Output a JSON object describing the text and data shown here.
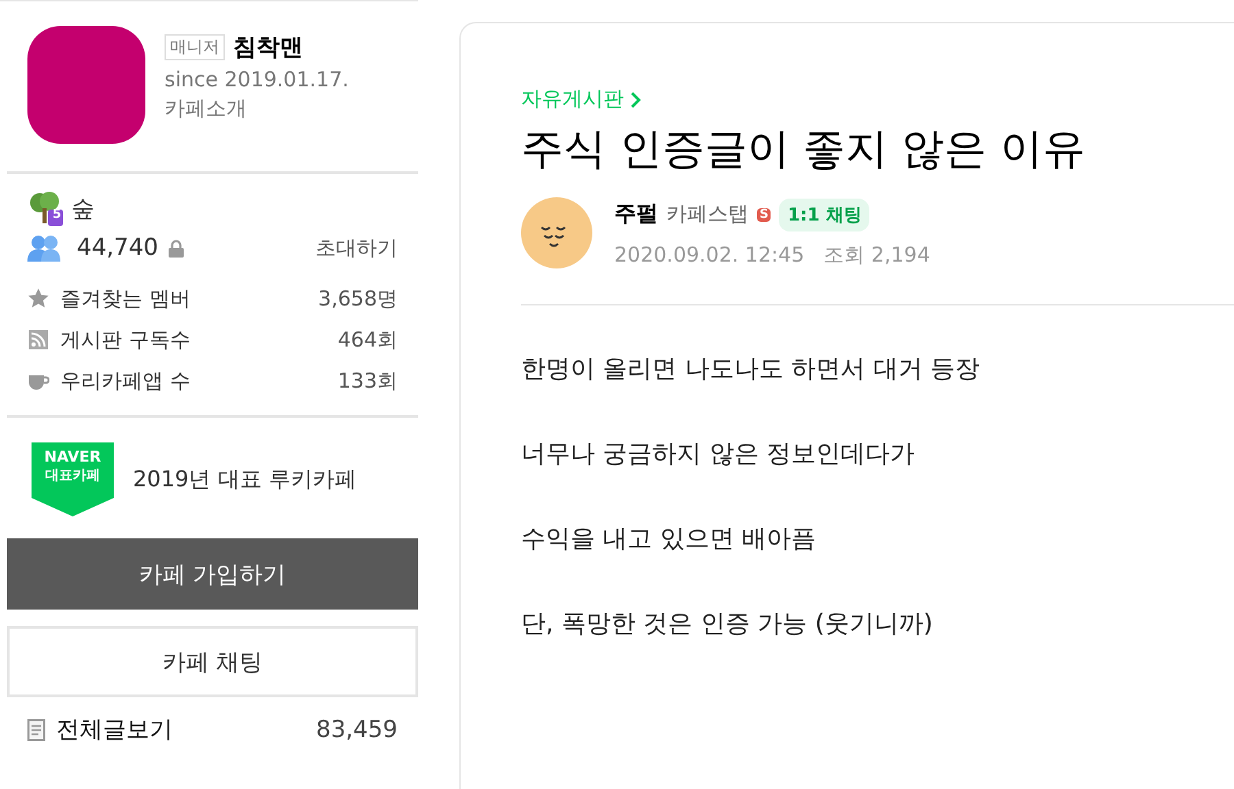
{
  "cafe": {
    "role_badge": "매니저",
    "manager": "침착맨",
    "since": "since 2019.01.17.",
    "intro_link": "카페소개"
  },
  "stats": {
    "level": "숲",
    "level_badge": "5",
    "members": "44,740",
    "invite": "초대하기",
    "rows": [
      {
        "kind": "star",
        "label": "즐겨찾는 멤버",
        "value": "3,658명"
      },
      {
        "kind": "rss",
        "label": "게시판 구독수",
        "value": "464회"
      },
      {
        "kind": "cup",
        "label": "우리카페앱 수",
        "value": "133회"
      }
    ]
  },
  "award": {
    "badge_top": "NAVER",
    "badge_bottom": "대표카페",
    "text": "2019년 대표 루키카페"
  },
  "buttons": [
    {
      "kind": "primary",
      "label": "카페 가입하기"
    },
    {
      "kind": "outline",
      "label": "카페 채팅"
    }
  ],
  "menu": [
    {
      "label": "전체글보기",
      "count": "83,459"
    }
  ],
  "article": {
    "board": "자유게시판",
    "title": "주식 인증글이 좋지 않은 이유",
    "author": "주펄",
    "author_level": "카페스탭",
    "staff_badge": "S",
    "chat": "1:1 채팅",
    "date": "2020.09.02. 12:45",
    "views": "조회 2,194",
    "paragraphs": [
      "한명이 올리면 나도나도 하면서 대거 등장",
      "너무나 궁금하지 않은 정보인데다가",
      "수익을 내고 있으면 배아픔",
      "단, 폭망한 것은 인증 가능 (웃기니까)"
    ]
  }
}
